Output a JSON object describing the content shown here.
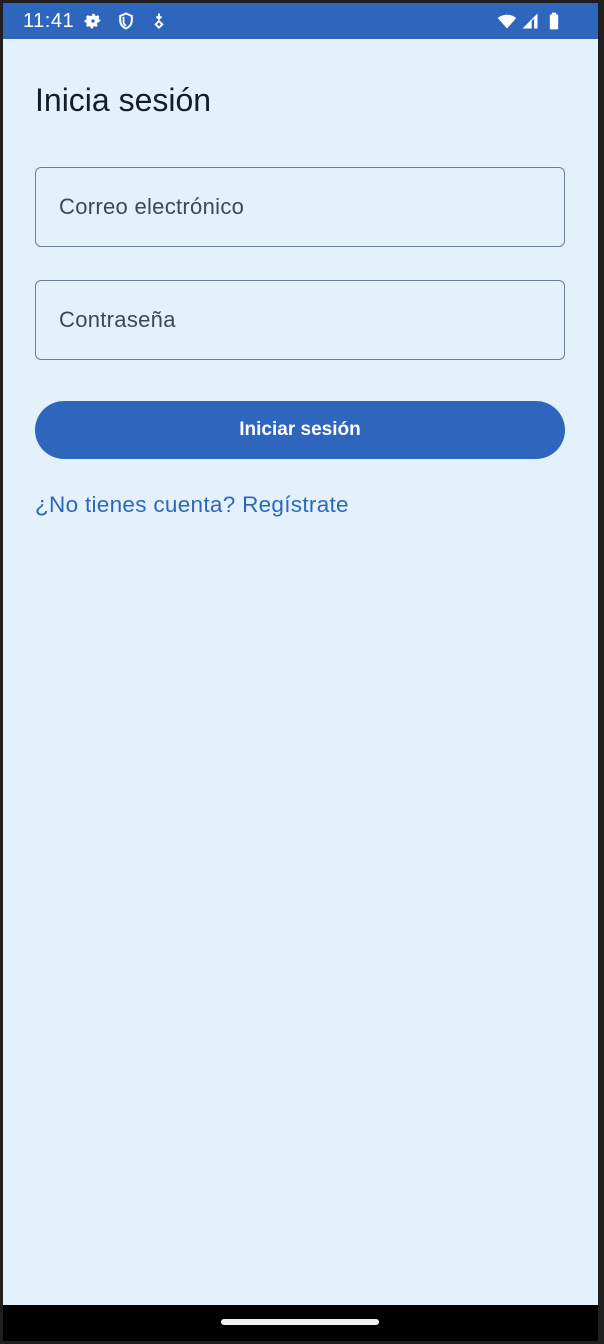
{
  "status_bar": {
    "time": "11:41",
    "left_icons": [
      "gear-icon",
      "shield-icon",
      "download-status-icon"
    ],
    "right_icons": [
      "wifi-icon",
      "cell-signal-icon",
      "battery-icon"
    ],
    "color": "#2f66bd"
  },
  "login": {
    "title": "Inicia sesión",
    "email_placeholder": "Correo electrónico",
    "password_placeholder": "Contraseña",
    "submit_label": "Iniciar sesión",
    "register_link": "¿No tienes cuenta? Regístrate"
  },
  "colors": {
    "background": "#e3f1fb",
    "accent": "#2f66bd"
  }
}
